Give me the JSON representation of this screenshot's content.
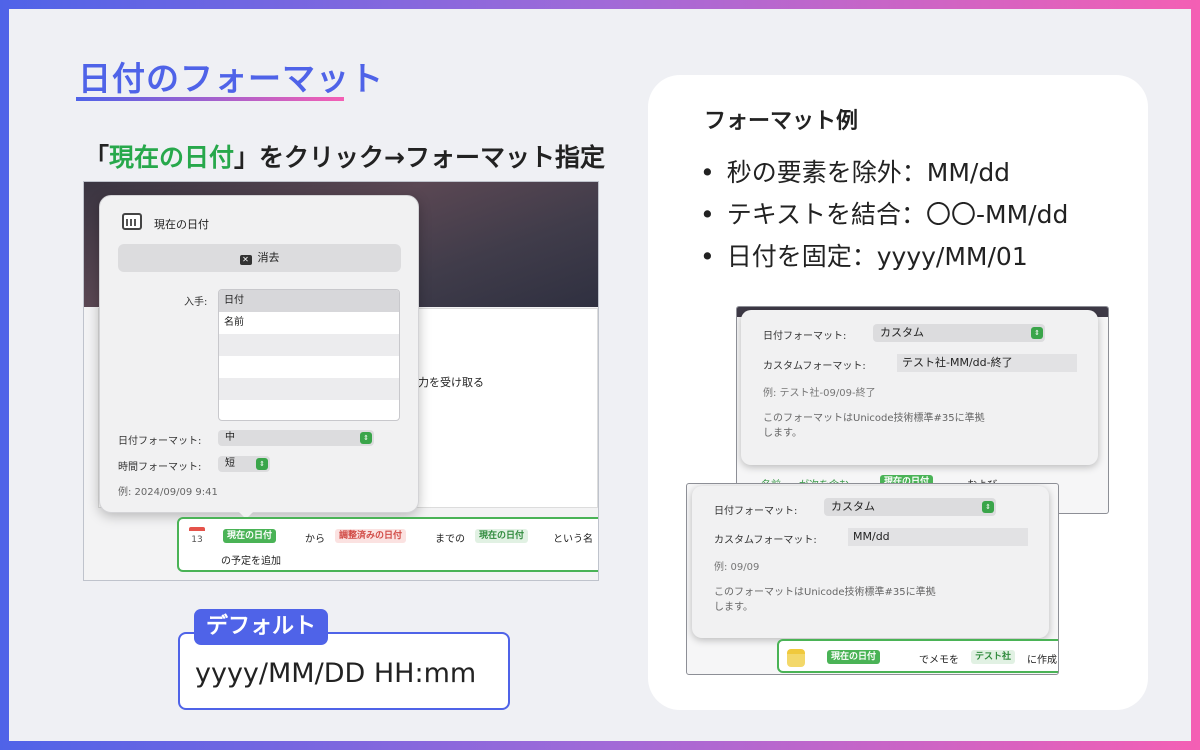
{
  "page": {
    "title": "日付のフォーマット",
    "subtitle_prefix": "「",
    "subtitle_highlight": "現在の日付",
    "subtitle_suffix": "」をクリック→フォーマット指定"
  },
  "left_shot": {
    "popover_title": "現在の日付",
    "clear_label": "消去",
    "input_label": "入手:",
    "list_items": [
      "日付",
      "名前",
      "",
      "",
      "",
      ""
    ],
    "date_format_label": "日付フォーマット:",
    "date_format_value": "中",
    "time_format_label": "時間フォーマット:",
    "time_format_value": "短",
    "example": "例: 2024/09/09 9:41",
    "background_text": "の入力を受け取る",
    "action": {
      "cal_day": "13",
      "token1": "現在の日付",
      "word1": "から",
      "token2": "調整済みの日付",
      "word2": "までの",
      "token3": "現在の日付",
      "word3": "という名",
      "line2": "の予定を追加"
    }
  },
  "default": {
    "tag": "デフォルト",
    "value": "yyyy/MM/DD HH:mm"
  },
  "right": {
    "title": "フォーマット例",
    "bullets": [
      "秒の要素を除外：MM/dd",
      "テキストを結合：〇〇-MM/dd",
      "日付を固定：yyyy/MM/01"
    ],
    "shot_a": {
      "date_format_label": "日付フォーマット:",
      "date_format_value": "カスタム",
      "custom_label": "カスタムフォーマット:",
      "custom_value": "テスト社-MM/dd-終了",
      "example": "例: テスト社-09/09-終了",
      "note_line1": "このフォーマットはUnicode技術標準#35に準拠",
      "note_line2": "します。",
      "bottom_word1": "名前",
      "bottom_word2": "が次を含む",
      "bottom_token": "現在の日付",
      "bottom_word3": "および"
    },
    "shot_b": {
      "date_format_label": "日付フォーマット:",
      "date_format_value": "カスタム",
      "custom_label": "カスタムフォーマット:",
      "custom_value": "MM/dd",
      "example": "例: 09/09",
      "note_line1": "このフォーマットはUnicode技術標準#35に準拠",
      "note_line2": "します。",
      "token1": "現在の日付",
      "word1": "でメモを",
      "token2": "テスト社",
      "word2": "に作成"
    }
  },
  "colors": {
    "accent_blue": "#4f63e8",
    "accent_pink": "#f45fb4",
    "highlight_green": "#27a84b"
  }
}
